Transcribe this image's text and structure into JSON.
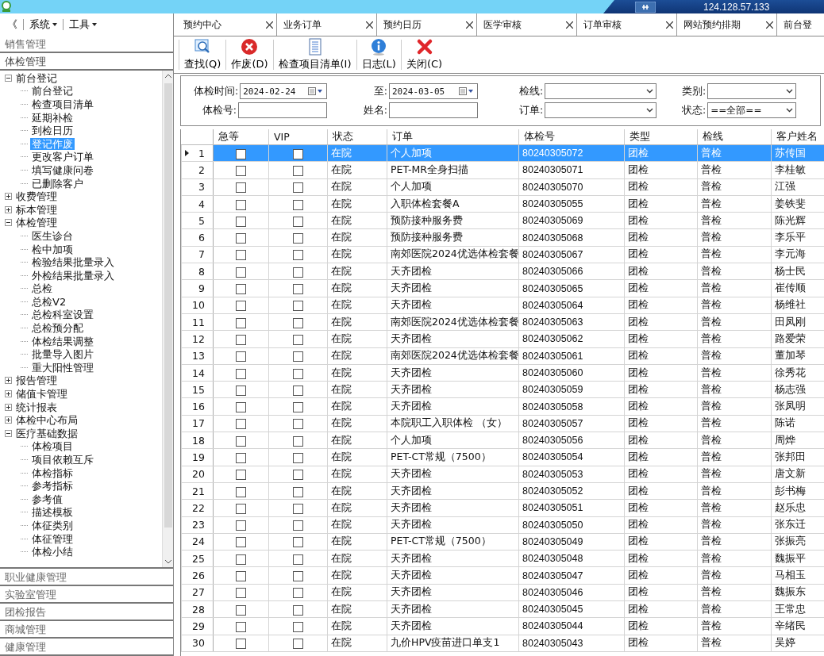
{
  "connection_bar": {
    "address": "124.128.57.133"
  },
  "menu": [
    {
      "label": "《",
      "kind": "plain"
    },
    {
      "label": "系统",
      "kind": "dropdown"
    },
    {
      "label": "工具",
      "kind": "dropdown"
    }
  ],
  "sidebar": {
    "sections_before": [
      {
        "label": "销售管理",
        "expanded": false
      },
      {
        "label": "体检管理",
        "expanded": true
      }
    ],
    "tree": [
      {
        "label": "前台登记",
        "selected": false,
        "expanded": true,
        "children": [
          {
            "label": "前台登记",
            "selected": false
          },
          {
            "label": "检查项目清单",
            "selected": false
          },
          {
            "label": "延期补检",
            "selected": false
          },
          {
            "label": "到检日历",
            "selected": false
          },
          {
            "label": "登记作废",
            "selected": true
          },
          {
            "label": "更改客户订单",
            "selected": false
          },
          {
            "label": "填写健康问卷",
            "selected": false
          },
          {
            "label": "已删除客户",
            "selected": false
          }
        ]
      },
      {
        "label": "收费管理",
        "selected": false,
        "expanded": false
      },
      {
        "label": "标本管理",
        "selected": false,
        "expanded": false
      },
      {
        "label": "体检管理",
        "selected": false,
        "expanded": true,
        "children": [
          {
            "label": "医生诊台",
            "selected": false
          },
          {
            "label": "检中加项",
            "selected": false
          },
          {
            "label": "检验结果批量录入",
            "selected": false
          },
          {
            "label": "外检结果批量录入",
            "selected": false
          },
          {
            "label": "总检",
            "selected": false
          },
          {
            "label": "总检V2",
            "selected": false
          },
          {
            "label": "总检科室设置",
            "selected": false
          },
          {
            "label": "总检预分配",
            "selected": false
          },
          {
            "label": "体检结果调整",
            "selected": false
          },
          {
            "label": "批量导入图片",
            "selected": false
          },
          {
            "label": "重大阳性管理",
            "selected": false
          }
        ]
      },
      {
        "label": "报告管理",
        "selected": false,
        "expanded": false
      },
      {
        "label": "储值卡管理",
        "selected": false,
        "expanded": false
      },
      {
        "label": "统计报表",
        "selected": false,
        "expanded": false
      },
      {
        "label": "体检中心布局",
        "selected": false,
        "expanded": false
      },
      {
        "label": "医疗基础数据",
        "selected": false,
        "expanded": true,
        "children": [
          {
            "label": "体检项目",
            "selected": false
          },
          {
            "label": "项目依赖互斥",
            "selected": false
          },
          {
            "label": "体检指标",
            "selected": false
          },
          {
            "label": "参考指标",
            "selected": false
          },
          {
            "label": "参考值",
            "selected": false
          },
          {
            "label": "描述模板",
            "selected": false
          },
          {
            "label": "体征类别",
            "selected": false
          },
          {
            "label": "体征管理",
            "selected": false
          },
          {
            "label": "体检小结",
            "selected": false
          }
        ]
      }
    ],
    "sections_after": [
      {
        "label": "职业健康管理",
        "expanded": false
      },
      {
        "label": "实验室管理",
        "expanded": false
      },
      {
        "label": "团检报告",
        "expanded": false
      },
      {
        "label": "商城管理",
        "expanded": false
      },
      {
        "label": "健康管理",
        "expanded": false
      }
    ]
  },
  "tabs": [
    {
      "label": "预约中心",
      "selected": false
    },
    {
      "label": "业务订单",
      "selected": false
    },
    {
      "label": "预约日历",
      "selected": false
    },
    {
      "label": "医学审核",
      "selected": false
    },
    {
      "label": "订单审核",
      "selected": false
    },
    {
      "label": "网站预约排期",
      "selected": false
    },
    {
      "label": "前台登",
      "selected": false
    }
  ],
  "toolbar": [
    {
      "label": "查找(Q)",
      "kind": "search"
    },
    {
      "label": "作废(D)",
      "kind": "void"
    },
    {
      "label": "检查项目清单(I)",
      "kind": "list"
    },
    {
      "label": "日志(L)",
      "kind": "log"
    },
    {
      "label": "关闭(C)",
      "kind": "close"
    }
  ],
  "filters": [
    {
      "label": "体检时间:",
      "kind": "date",
      "value": "2024-02-24"
    },
    {
      "label": "至:",
      "kind": "date",
      "value": "2024-03-05"
    },
    {
      "label": "检线:",
      "kind": "select"
    },
    {
      "label": "类别:",
      "kind": "select"
    },
    {
      "label": "体检号:",
      "kind": "text"
    },
    {
      "label": "姓名:",
      "kind": "text"
    },
    {
      "label": "订单:",
      "kind": "select"
    },
    {
      "label": "状态:",
      "kind": "select",
      "value": "==全部=="
    }
  ],
  "table": {
    "columns": [
      "急等",
      "VIP",
      "状态",
      "订单",
      "体检号",
      "类型",
      "检线",
      "客户姓名"
    ],
    "rows": [
      {
        "no": "1",
        "urgent": false,
        "vip": false,
        "status": "在院",
        "order": "个人加项",
        "id": "80240305072",
        "type": "团检",
        "line": "普检",
        "name": "苏传国",
        "selected": true
      },
      {
        "no": "2",
        "urgent": false,
        "vip": false,
        "status": "在院",
        "order": "PET-MR全身扫描",
        "id": "80240305071",
        "type": "团检",
        "line": "普检",
        "name": "李桂敏",
        "selected": false
      },
      {
        "no": "3",
        "urgent": false,
        "vip": false,
        "status": "在院",
        "order": "个人加项",
        "id": "80240305070",
        "type": "团检",
        "line": "普检",
        "name": "江强",
        "selected": false
      },
      {
        "no": "4",
        "urgent": false,
        "vip": false,
        "status": "在院",
        "order": "入职体检套餐A",
        "id": "80240305055",
        "type": "团检",
        "line": "普检",
        "name": "姜铁斐",
        "selected": false
      },
      {
        "no": "5",
        "urgent": false,
        "vip": false,
        "status": "在院",
        "order": "预防接种服务费",
        "id": "80240305069",
        "type": "团检",
        "line": "普检",
        "name": "陈光辉",
        "selected": false
      },
      {
        "no": "6",
        "urgent": false,
        "vip": false,
        "status": "在院",
        "order": "预防接种服务费",
        "id": "80240305068",
        "type": "团检",
        "line": "普检",
        "name": "李乐平",
        "selected": false
      },
      {
        "no": "7",
        "urgent": false,
        "vip": false,
        "status": "在院",
        "order": "南郊医院2024优选体检套餐",
        "id": "80240305067",
        "type": "团检",
        "line": "普检",
        "name": "李元海",
        "selected": false
      },
      {
        "no": "8",
        "urgent": false,
        "vip": false,
        "status": "在院",
        "order": "天齐团检",
        "id": "80240305066",
        "type": "团检",
        "line": "普检",
        "name": "杨士民",
        "selected": false
      },
      {
        "no": "9",
        "urgent": false,
        "vip": false,
        "status": "在院",
        "order": "天齐团检",
        "id": "80240305065",
        "type": "团检",
        "line": "普检",
        "name": "崔传顺",
        "selected": false
      },
      {
        "no": "10",
        "urgent": false,
        "vip": false,
        "status": "在院",
        "order": "天齐团检",
        "id": "80240305064",
        "type": "团检",
        "line": "普检",
        "name": "杨维社",
        "selected": false
      },
      {
        "no": "11",
        "urgent": false,
        "vip": false,
        "status": "在院",
        "order": "南郊医院2024优选体检套餐",
        "id": "80240305063",
        "type": "团检",
        "line": "普检",
        "name": "田凤刚",
        "selected": false
      },
      {
        "no": "12",
        "urgent": false,
        "vip": false,
        "status": "在院",
        "order": "天齐团检",
        "id": "80240305062",
        "type": "团检",
        "line": "普检",
        "name": "路爱荣",
        "selected": false
      },
      {
        "no": "13",
        "urgent": false,
        "vip": false,
        "status": "在院",
        "order": "南郊医院2024优选体检套餐",
        "id": "80240305061",
        "type": "团检",
        "line": "普检",
        "name": "董加琴",
        "selected": false
      },
      {
        "no": "14",
        "urgent": false,
        "vip": false,
        "status": "在院",
        "order": "天齐团检",
        "id": "80240305060",
        "type": "团检",
        "line": "普检",
        "name": "徐秀花",
        "selected": false
      },
      {
        "no": "15",
        "urgent": false,
        "vip": false,
        "status": "在院",
        "order": "天齐团检",
        "id": "80240305059",
        "type": "团检",
        "line": "普检",
        "name": "杨志强",
        "selected": false
      },
      {
        "no": "16",
        "urgent": false,
        "vip": false,
        "status": "在院",
        "order": "天齐团检",
        "id": "80240305058",
        "type": "团检",
        "line": "普检",
        "name": "张凤明",
        "selected": false
      },
      {
        "no": "17",
        "urgent": false,
        "vip": false,
        "status": "在院",
        "order": "本院职工入职体检 （女）",
        "id": "80240305057",
        "type": "团检",
        "line": "普检",
        "name": "陈诺",
        "selected": false
      },
      {
        "no": "18",
        "urgent": false,
        "vip": false,
        "status": "在院",
        "order": "个人加项",
        "id": "80240305056",
        "type": "团检",
        "line": "普检",
        "name": "周烨",
        "selected": false
      },
      {
        "no": "19",
        "urgent": false,
        "vip": false,
        "status": "在院",
        "order": "PET-CT常规（7500）",
        "id": "80240305054",
        "type": "团检",
        "line": "普检",
        "name": "张邦田",
        "selected": false
      },
      {
        "no": "20",
        "urgent": false,
        "vip": false,
        "status": "在院",
        "order": "天齐团检",
        "id": "80240305053",
        "type": "团检",
        "line": "普检",
        "name": "唐文新",
        "selected": false
      },
      {
        "no": "21",
        "urgent": false,
        "vip": false,
        "status": "在院",
        "order": "天齐团检",
        "id": "80240305052",
        "type": "团检",
        "line": "普检",
        "name": "彭书梅",
        "selected": false
      },
      {
        "no": "22",
        "urgent": false,
        "vip": false,
        "status": "在院",
        "order": "天齐团检",
        "id": "80240305051",
        "type": "团检",
        "line": "普检",
        "name": "赵乐忠",
        "selected": false
      },
      {
        "no": "23",
        "urgent": false,
        "vip": false,
        "status": "在院",
        "order": "天齐团检",
        "id": "80240305050",
        "type": "团检",
        "line": "普检",
        "name": "张东迁",
        "selected": false
      },
      {
        "no": "24",
        "urgent": false,
        "vip": false,
        "status": "在院",
        "order": "PET-CT常规（7500）",
        "id": "80240305049",
        "type": "团检",
        "line": "普检",
        "name": "张振亮",
        "selected": false
      },
      {
        "no": "25",
        "urgent": false,
        "vip": false,
        "status": "在院",
        "order": "天齐团检",
        "id": "80240305048",
        "type": "团检",
        "line": "普检",
        "name": "魏振平",
        "selected": false
      },
      {
        "no": "26",
        "urgent": false,
        "vip": false,
        "status": "在院",
        "order": "天齐团检",
        "id": "80240305047",
        "type": "团检",
        "line": "普检",
        "name": "马相玉",
        "selected": false
      },
      {
        "no": "27",
        "urgent": false,
        "vip": false,
        "status": "在院",
        "order": "天齐团检",
        "id": "80240305046",
        "type": "团检",
        "line": "普检",
        "name": "魏振东",
        "selected": false
      },
      {
        "no": "28",
        "urgent": false,
        "vip": false,
        "status": "在院",
        "order": "天齐团检",
        "id": "80240305045",
        "type": "团检",
        "line": "普检",
        "name": "王常忠",
        "selected": false
      },
      {
        "no": "29",
        "urgent": false,
        "vip": false,
        "status": "在院",
        "order": "天齐团检",
        "id": "80240305044",
        "type": "团检",
        "line": "普检",
        "name": "辛绪民",
        "selected": false
      },
      {
        "no": "30",
        "urgent": false,
        "vip": false,
        "status": "在院",
        "order": "九价HPV疫苗进口单支1",
        "id": "80240305043",
        "type": "团检",
        "line": "普检",
        "name": "吴婷",
        "selected": false
      }
    ]
  }
}
